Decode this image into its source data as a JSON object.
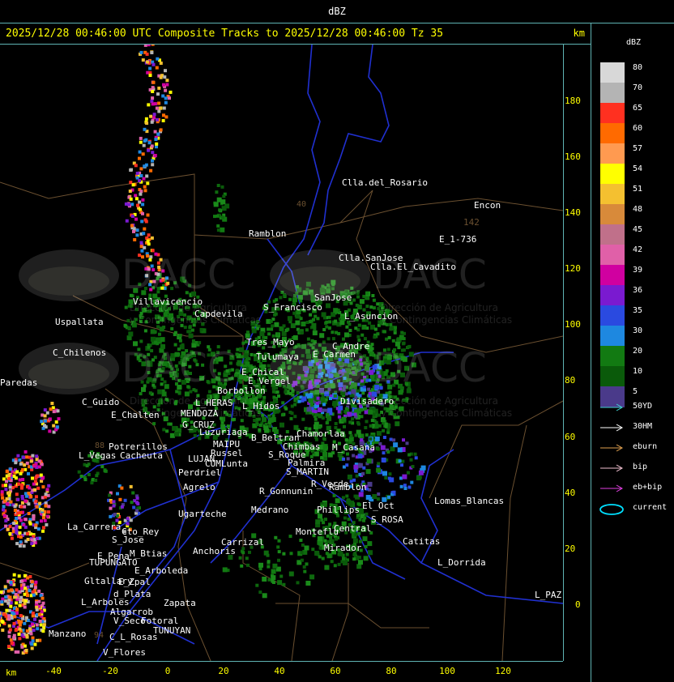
{
  "title": "dBZ",
  "header": {
    "text": "2025/12/28 00:46:00 UTC Composite Tracks to 2025/12/28 00:46:00 Tz 35",
    "unit": "km"
  },
  "axes": {
    "x_unit": "km",
    "x_ticks": [
      "-40",
      "-20",
      "0",
      "20",
      "40",
      "60",
      "80",
      "100",
      "120"
    ],
    "y_ticks": [
      "180",
      "160",
      "140",
      "120",
      "100",
      "80",
      "60",
      "40",
      "20",
      "0"
    ]
  },
  "legend": {
    "title": "dBZ",
    "scale": [
      {
        "label": "80",
        "color": "#d8d8d8"
      },
      {
        "label": "70",
        "color": "#b4b4b4"
      },
      {
        "label": "65",
        "color": "#ff3020"
      },
      {
        "label": "60",
        "color": "#ff6a00"
      },
      {
        "label": "57",
        "color": "#ff9a50"
      },
      {
        "label": "54",
        "color": "#ffff00"
      },
      {
        "label": "51",
        "color": "#f4c030"
      },
      {
        "label": "48",
        "color": "#d88a3a"
      },
      {
        "label": "45",
        "color": "#c0708a"
      },
      {
        "label": "42",
        "color": "#e060a8"
      },
      {
        "label": "39",
        "color": "#d000a0"
      },
      {
        "label": "36",
        "color": "#7a1ad0"
      },
      {
        "label": "35",
        "color": "#2a4ae0"
      },
      {
        "label": "30",
        "color": "#1e88e0"
      },
      {
        "label": "20",
        "color": "#127a12"
      },
      {
        "label": "10",
        "color": "#0a5a0a"
      },
      {
        "label": "5",
        "color": "#4a3a8a"
      }
    ],
    "tracks": [
      {
        "label": "50YD",
        "color": "#40d0d0"
      },
      {
        "label": "30HM",
        "color": "#ffffff"
      },
      {
        "label": "eburn",
        "color": "#e0a050"
      },
      {
        "label": "bip",
        "color": "#f0c0d0"
      },
      {
        "label": "eb+bip",
        "color": "#e040e0"
      },
      {
        "label": "current",
        "color": "#00e0ff"
      }
    ]
  },
  "places": [
    "Clla.del_Rosario",
    "Encon",
    "142",
    "E_1-736",
    "Ramblon",
    "Clla.SanJose",
    "Clla.El_Cavadito",
    "Villavicencio",
    "Capdevila",
    "S_Francisco",
    "SanJose",
    "L_Asuncion",
    "Uspallata",
    "Tres_Mayo",
    "C_Andre",
    "E_Carmen",
    "C_Chilenos",
    "Tulumaya",
    "E_Chical",
    "E_Vergel",
    "Paredas",
    "Borbollon",
    "C_Guido",
    "L_HERAS",
    "L_Hidos",
    "Divisadero",
    "E_Chalten",
    "MENDOZA",
    "G_CRUZ",
    "Luzuriaga",
    "B_Beltran",
    "Chamorlaa",
    "MAIPU",
    "Russel",
    "Potrerillos",
    "Chimbas",
    "M_Casana",
    "L_Vegas",
    "Cacheuta",
    "LUJAN",
    "CUMLunta",
    "S_Roque",
    "Palmira",
    "Perdriel",
    "S_MARTIN",
    "Agrelo",
    "R_Verde",
    "Ramblon",
    "R_Gonnunin",
    "Lomas_Blancas",
    "Ugarteche",
    "Medrano",
    "Phillips",
    "El_Oct",
    "La_Carrera",
    "Cto_Rey",
    "S_Jose",
    "S_ROSA",
    "Carrizal",
    "Monteflu",
    "Central",
    "Catitas",
    "E_Pena",
    "M_Btias",
    "Anchoris",
    "TUPUNGATO",
    "Mirador",
    "L_Dorrida",
    "E_Arboleda",
    "Gltallary",
    "E_Zpal",
    "d_Plata",
    "L_PAZ",
    "L_Arboles",
    "Zapata",
    "Algarrob",
    "V_Seco",
    "Fotoral",
    "TUNUYAN",
    "Manzano",
    "C_L_Rosas",
    "V_Flores",
    "88",
    "40",
    "94"
  ],
  "watermarks": {
    "brand": "DACC",
    "line1": "Dirección de Agricultura",
    "line2": "y Contingencias Climáticas"
  }
}
